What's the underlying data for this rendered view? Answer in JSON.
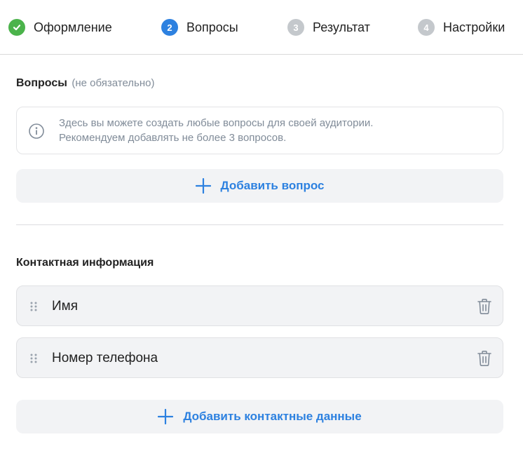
{
  "steps": [
    {
      "label": "Оформление",
      "number": "",
      "state": "done",
      "icon": "check-icon"
    },
    {
      "label": "Вопросы",
      "number": "2",
      "state": "active"
    },
    {
      "label": "Результат",
      "number": "3",
      "state": "inactive"
    },
    {
      "label": "Настройки",
      "number": "4",
      "state": "inactive"
    }
  ],
  "questions": {
    "title": "Вопросы",
    "optional": "(не обязательно)",
    "info_icon": "info-icon",
    "info_lines": [
      "Здесь вы можете создать любые вопросы для своей аудитории.",
      "Рекомендуем добавлять не более 3 вопросов."
    ],
    "add_label": "Добавить вопрос",
    "add_icon": "plus-icon"
  },
  "contacts": {
    "title": "Контактная информация",
    "items": [
      {
        "label": "Имя",
        "drag_icon": "drag-handle-icon",
        "delete_icon": "trash-icon"
      },
      {
        "label": "Номер телефона",
        "drag_icon": "drag-handle-icon",
        "delete_icon": "trash-icon"
      }
    ],
    "add_label": "Добавить контактные данные",
    "add_icon": "plus-icon"
  },
  "colors": {
    "accent": "#2d81e0",
    "success": "#4bb34b",
    "inactive": "#c4c8cc",
    "muted_text": "#818c99",
    "button_bg": "#f2f3f5"
  }
}
